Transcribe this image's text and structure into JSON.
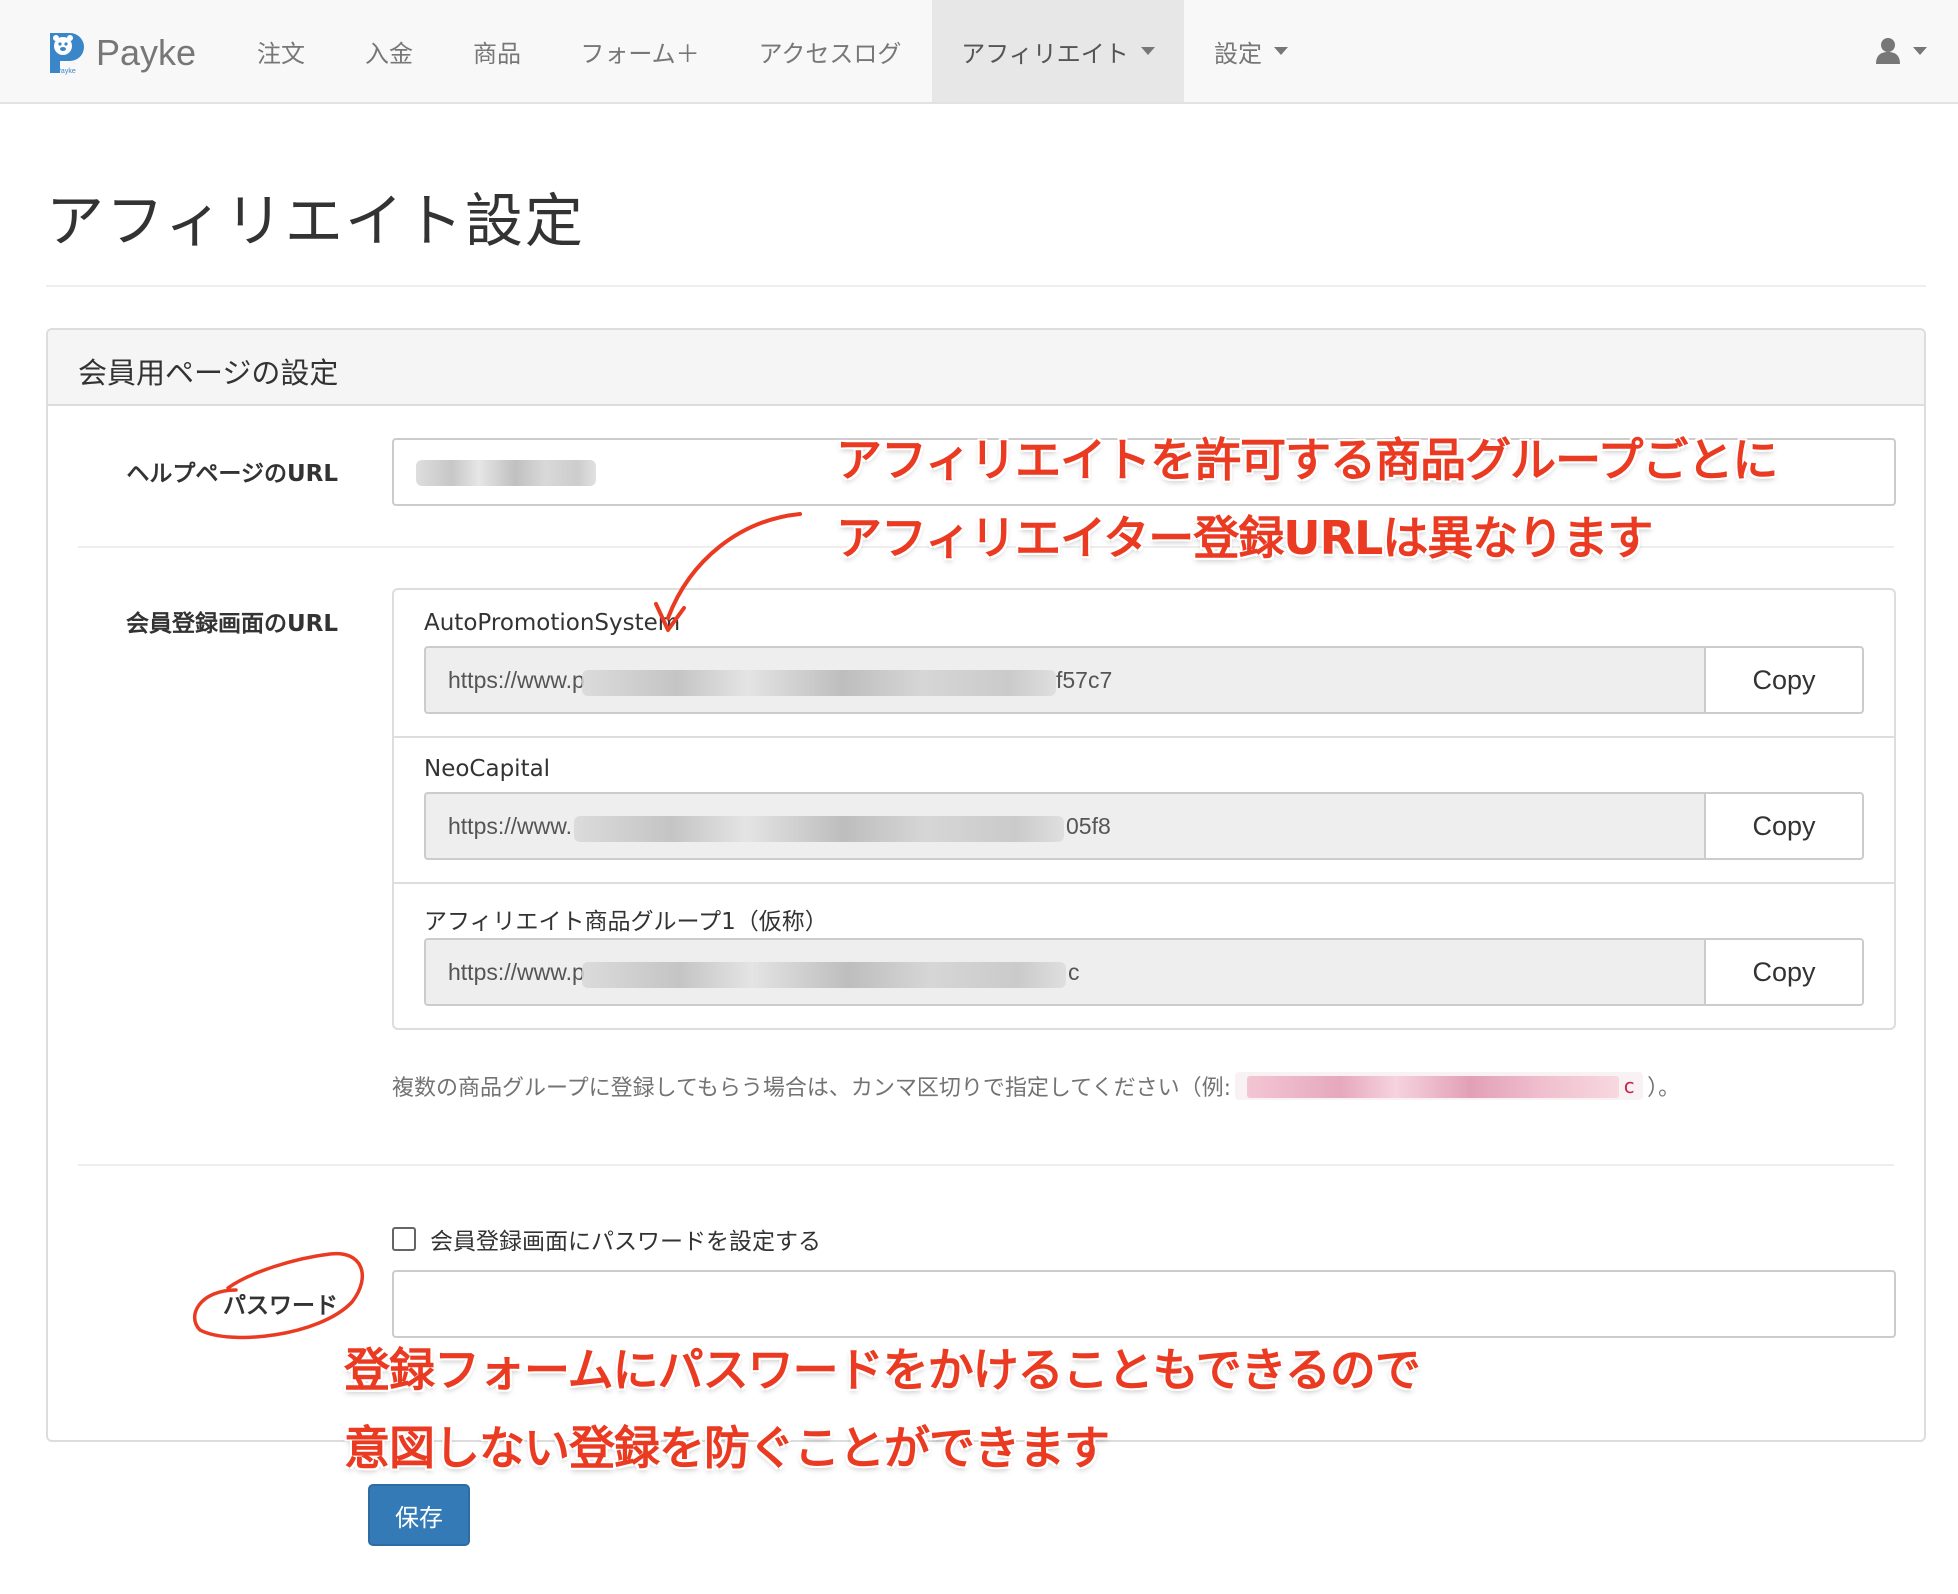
{
  "navbar": {
    "brand": "Payke",
    "brand_logo_caption": "Payke",
    "items": [
      "注文",
      "入金",
      "商品",
      "フォーム＋",
      "アクセスログ",
      "アフィリエイト",
      "設定"
    ],
    "active_item": "アフィリエイト",
    "user_icon": "user-icon"
  },
  "page": {
    "title": "アフィリエイト設定"
  },
  "panel": {
    "heading": "会員用ページの設定",
    "help_url_label": "ヘルプページのURL",
    "register_url_label": "会員登録画面のURL",
    "url_groups": [
      {
        "name": "AutoPromotionSystem",
        "url_prefix": "https://www.p",
        "url_suffix": "f57c7",
        "copy_label": "Copy"
      },
      {
        "name": "NeoCapital",
        "url_prefix": "https://www.",
        "url_suffix": "05f8",
        "copy_label": "Copy"
      },
      {
        "name": "アフィリエイト商品グループ1（仮称）",
        "url_prefix": "https://www.p",
        "url_suffix": "c",
        "copy_label": "Copy"
      }
    ],
    "help_text_before": "複数の商品グループに登録してもらう場合は、カンマ区切りで指定してください（例: ",
    "help_text_code_suffix": "c",
    "help_text_after": "）。",
    "password_checkbox_label": "会員登録画面にパスワードを設定する",
    "password_checkbox_checked": false,
    "password_label": "パスワード",
    "password_value": ""
  },
  "save_label": "保存",
  "annotations": {
    "top_line1": "アフィリエイトを許可する商品グループごとに",
    "top_line2": "アフィリエイター登録URLは異なります",
    "bottom_line1": "登録フォームにパスワードをかけることもできるので",
    "bottom_line2": "意図しない登録を防ぐことができます",
    "color": "#ea3b22"
  },
  "colors": {
    "primary": "#337ab7",
    "navbar_bg": "#f8f8f8",
    "annotation": "#ea3b22"
  }
}
